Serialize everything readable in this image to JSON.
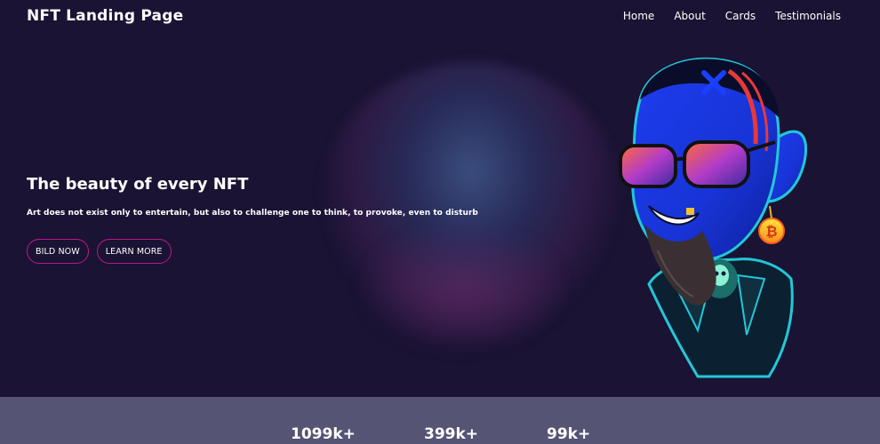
{
  "header": {
    "brand": "NFT Landing Page",
    "nav": [
      "Home",
      "About",
      "Cards",
      "Testimonials"
    ]
  },
  "hero": {
    "title": "The beauty of every NFT",
    "subtitle": "Art does not exist only to entertain, but also to challenge one to think, to provoke, even to disturb",
    "buttons": [
      "BILD NOW",
      "LEARN MORE"
    ]
  },
  "stats": [
    "1099k+",
    "399k+",
    "99k+"
  ],
  "colors": {
    "background": "#1a1333",
    "button_border": "#c0188f",
    "stats_band": "#555474"
  }
}
